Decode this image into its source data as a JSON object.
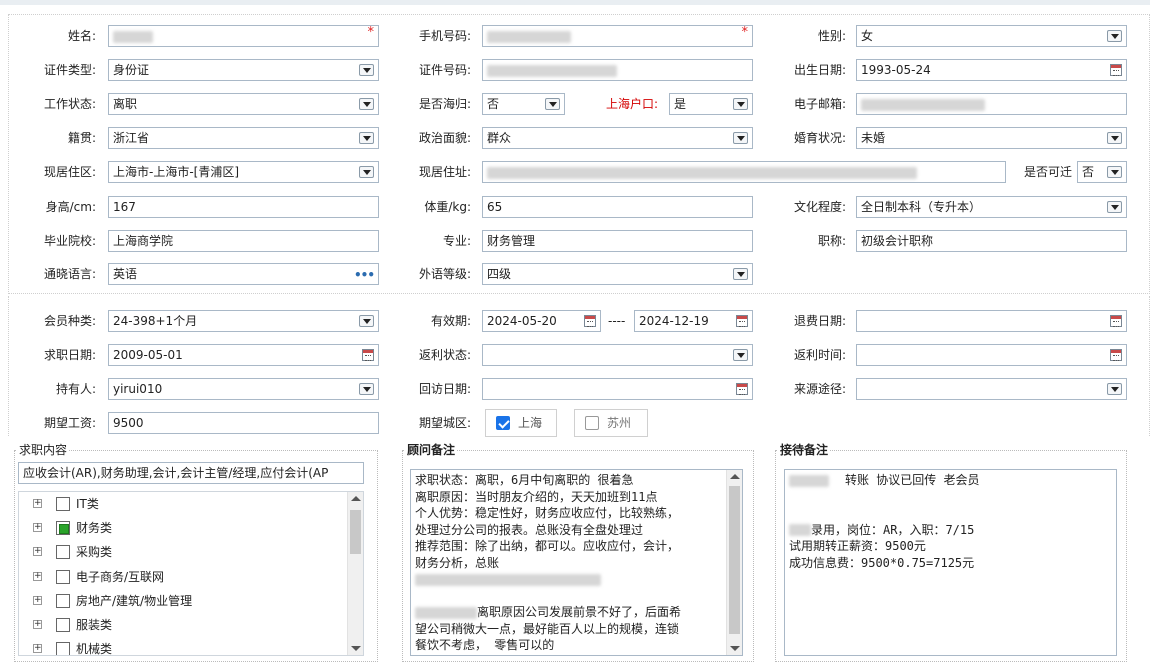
{
  "personal": {
    "name": {
      "label": "姓名:",
      "value": ""
    },
    "mobile": {
      "label": "手机号码:",
      "value": ""
    },
    "gender": {
      "label": "性别:",
      "value": "女"
    },
    "id_type": {
      "label": "证件类型:",
      "value": "身份证"
    },
    "id_number": {
      "label": "证件号码:",
      "value": ""
    },
    "birth_date": {
      "label": "出生日期:",
      "value": "1993-05-24"
    },
    "work_status": {
      "label": "工作状态:",
      "value": "离职"
    },
    "returnee": {
      "label": "是否海归:",
      "value": "否"
    },
    "shanghai_hukou": {
      "label": "上海户口:",
      "value": "是"
    },
    "email": {
      "label": "电子邮箱:",
      "value": ""
    },
    "native_place": {
      "label": "籍贯:",
      "value": "浙江省"
    },
    "political": {
      "label": "政治面貌:",
      "value": "群众"
    },
    "marital": {
      "label": "婚育状况:",
      "value": "未婚"
    },
    "residence_area": {
      "label": "现居住区:",
      "value": "上海市-上海市-[青浦区]"
    },
    "address": {
      "label": "现居住址:",
      "value": ""
    },
    "relocate": {
      "label": "是否可迁",
      "value": "否"
    },
    "height": {
      "label": "身高/cm:",
      "value": "167"
    },
    "weight": {
      "label": "体重/kg:",
      "value": "65"
    },
    "education": {
      "label": "文化程度:",
      "value": "全日制本科（专升本）"
    },
    "school": {
      "label": "毕业院校:",
      "value": "上海商学院"
    },
    "major": {
      "label": "专业:",
      "value": "财务管理"
    },
    "title": {
      "label": "职称:",
      "value": "初级会计职称"
    },
    "language": {
      "label": "通晓语言:",
      "value": "英语",
      "more_icon": "ellipsis-icon"
    },
    "language_level": {
      "label": "外语等级:",
      "value": "四级"
    }
  },
  "membership": {
    "member_type": {
      "label": "会员种类:",
      "value": "24-398+1个月"
    },
    "valid_period": {
      "label": "有效期:",
      "start": "2024-05-20",
      "separator": "----",
      "end": "2024-12-19"
    },
    "refund_date": {
      "label": "退费日期:",
      "value": ""
    },
    "job_date": {
      "label": "求职日期:",
      "value": "2009-05-01"
    },
    "rebate_status": {
      "label": "返利状态:",
      "value": ""
    },
    "rebate_time": {
      "label": "返利时间:",
      "value": ""
    },
    "holder": {
      "label": "持有人:",
      "value": "yirui010"
    },
    "revisit_date": {
      "label": "回访日期:",
      "value": ""
    },
    "source": {
      "label": "来源途径:",
      "value": ""
    },
    "expected_salary": {
      "label": "期望工资:",
      "value": "9500"
    },
    "expected_city": {
      "label": "期望城区:",
      "options": [
        {
          "label": "上海",
          "checked": true
        },
        {
          "label": "苏州",
          "checked": false
        }
      ]
    }
  },
  "job_content": {
    "title": "求职内容",
    "summary": "应收会计(AR),财务助理,会计,会计主管/经理,应付会计(AP",
    "categories": [
      {
        "label": "IT类",
        "checked": false
      },
      {
        "label": "财务类",
        "checked": true
      },
      {
        "label": "采购类",
        "checked": false
      },
      {
        "label": "电子商务/互联网",
        "checked": false
      },
      {
        "label": "房地产/建筑/物业管理",
        "checked": false
      },
      {
        "label": "服装类",
        "checked": false
      },
      {
        "label": "机械类",
        "checked": false
      }
    ]
  },
  "consultant_notes": {
    "title": "顾问备注",
    "lines": [
      "求职状态：离职，6月中旬离职的  很着急",
      "离职原因：当时朋友介绍的，天天加班到11点",
      "个人优势：稳定性好，财务应收应付，比较熟练，",
      "处理过分公司的报表。总账没有全盘处理过",
      "推荐范围：除了出纳，都可以。应收应付，会计，",
      "财务分析，总账",
      "",
      "",
      "离职原因公司发展前景不好了，后面希",
      "望公司稍微大一点，最好能百人以上的规模，连锁",
      "餐饮不考虑， 零售可以的"
    ]
  },
  "reception_notes": {
    "title": "接待备注",
    "lines": [
      "转账   协议已回传 老会员",
      "",
      "",
      "录用，岗位：AR，入职：7/15",
      "试用期转正薪资：9500元",
      "成功信息费：9500*0.75=7125元"
    ]
  },
  "colors": {
    "border": "#a9b8c7",
    "required": "#e02020",
    "hukou_label": "#d40000",
    "checked": "#1a73e8",
    "tree_checked": "#2aa32a"
  }
}
